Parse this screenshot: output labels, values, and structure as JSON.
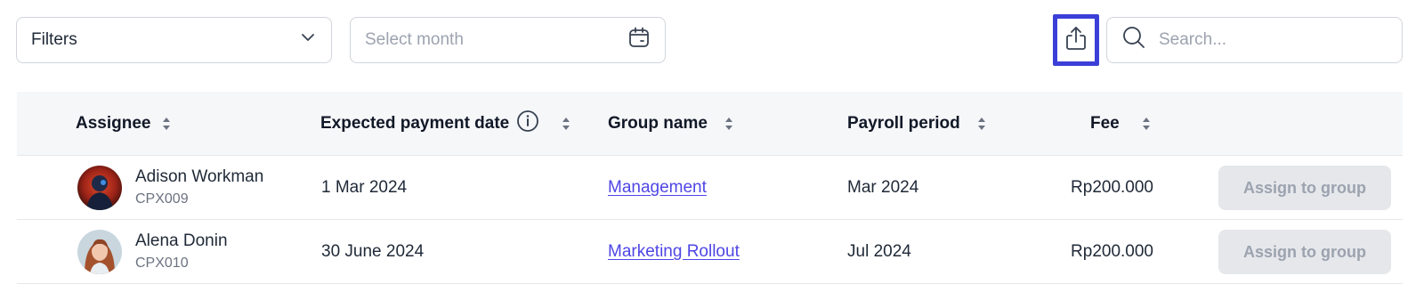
{
  "toolbar": {
    "filters_label": "Filters",
    "month_placeholder": "Select month",
    "search_placeholder": "Search..."
  },
  "table": {
    "columns": [
      "Assignee",
      "Expected payment date",
      "Group name",
      "Payroll period",
      "Fee"
    ],
    "rows": [
      {
        "name": "Adison Workman",
        "code": "CPX009",
        "date": "1 Mar 2024",
        "group": "Management",
        "period": "Mar 2024",
        "fee": "Rp200.000",
        "action": "Assign to group"
      },
      {
        "name": "Alena Donin",
        "code": "CPX010",
        "date": "30 June 2024",
        "group": "Marketing Rollout",
        "period": "Jul 2024",
        "fee": "Rp200.000",
        "action": "Assign to group"
      }
    ]
  },
  "colors": {
    "accent": "#3b3fd8",
    "link": "#4f46e5",
    "header_bg": "#f6f7f9",
    "button_bg": "#e5e7eb"
  },
  "icons": [
    "chevron-down-icon",
    "calendar-icon",
    "export-icon",
    "search-icon",
    "info-icon",
    "sort-icon"
  ]
}
